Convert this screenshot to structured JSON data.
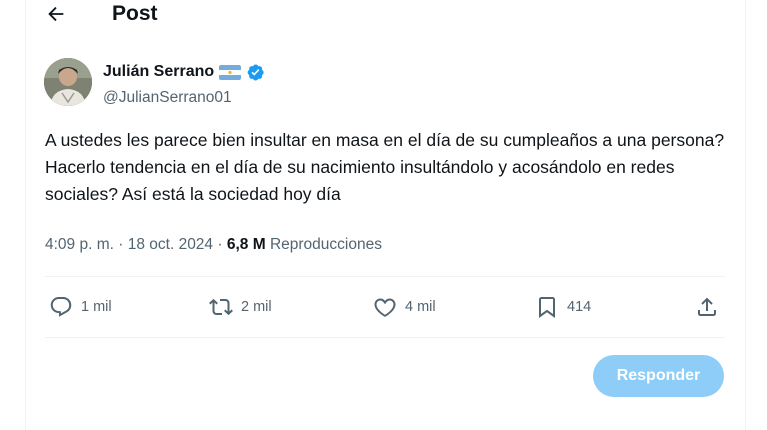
{
  "header": {
    "back_icon": "arrow-left-icon",
    "title": "Post"
  },
  "author": {
    "name": "Julián Serrano",
    "handle": "@JulianSerrano01",
    "flag_icon": "argentina-flag-icon",
    "verified_icon": "verified-badge-icon",
    "verified_color": "#1d9bf0"
  },
  "tweet": {
    "text": "A ustedes les parece bien insultar en masa en el día de su cumpleaños a una persona? Hacerlo tendencia en el día de su nacimiento insultándolo y acosándolo en redes sociales? Así está la sociedad hoy día",
    "time": "4:09 p. m.",
    "separator": "·",
    "date": "18 oct. 2024",
    "views_count": "6,8 M",
    "views_label": "Reproducciones"
  },
  "actions": {
    "replies": "1 mil",
    "reposts": "2 mil",
    "likes": "4 mil",
    "bookmarks": "414",
    "reply_icon": "comment-icon",
    "repost_icon": "repost-icon",
    "like_icon": "heart-icon",
    "bookmark_icon": "bookmark-icon",
    "share_icon": "share-icon"
  },
  "reply_button": {
    "label": "Responder",
    "color": "#8ecdf7"
  }
}
